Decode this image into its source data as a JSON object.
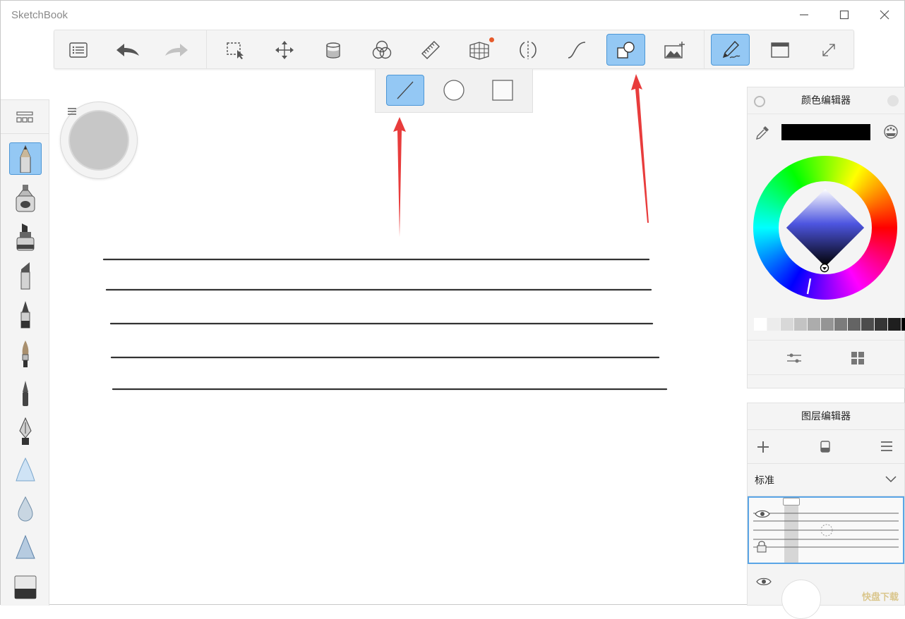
{
  "app": {
    "title": "SketchBook"
  },
  "window_controls": {
    "minimize": "minimize-icon",
    "maximize": "maximize-icon",
    "close": "close-icon"
  },
  "toolbar": {
    "items": [
      {
        "name": "brush-list",
        "icon": "list-icon"
      },
      {
        "name": "undo",
        "icon": "undo-icon"
      },
      {
        "name": "redo",
        "icon": "redo-icon"
      },
      {
        "name": "select",
        "icon": "select-icon"
      },
      {
        "name": "transform",
        "icon": "move-icon"
      },
      {
        "name": "fill",
        "icon": "bucket-icon"
      },
      {
        "name": "symmetry-color",
        "icon": "color-circles-icon"
      },
      {
        "name": "ruler",
        "icon": "ruler-icon"
      },
      {
        "name": "perspective",
        "icon": "perspective-icon"
      },
      {
        "name": "symmetry",
        "icon": "symmetry-icon"
      },
      {
        "name": "curve",
        "icon": "curve-icon"
      },
      {
        "name": "shapes",
        "icon": "shapes-icon",
        "active": true
      },
      {
        "name": "add-image",
        "icon": "add-image-icon"
      },
      {
        "name": "brush-pen",
        "icon": "pen-icon",
        "active": true
      },
      {
        "name": "window",
        "icon": "window-icon"
      },
      {
        "name": "fullscreen",
        "icon": "expand-icon"
      }
    ]
  },
  "shape_popup": {
    "items": [
      {
        "name": "line",
        "icon": "line-icon",
        "active": true
      },
      {
        "name": "ellipse",
        "icon": "circle-icon"
      },
      {
        "name": "rectangle",
        "icon": "square-icon"
      }
    ]
  },
  "color_editor": {
    "title": "颜色编辑器",
    "current_color": "#000000",
    "grays": [
      "#ffffff",
      "#ececec",
      "#d8d8d8",
      "#c3c3c3",
      "#acacac",
      "#959595",
      "#7c7c7c",
      "#646464",
      "#4c4c4c",
      "#363636",
      "#1f1f1f",
      "#000000"
    ]
  },
  "layer_editor": {
    "title": "图层编辑器",
    "blend_mode": "标准"
  },
  "watermark": {
    "text": "快盘下载"
  },
  "colors": {
    "accent": "#94c8f4",
    "accent_border": "#4d97d6",
    "arrow": "#e83c3c"
  }
}
